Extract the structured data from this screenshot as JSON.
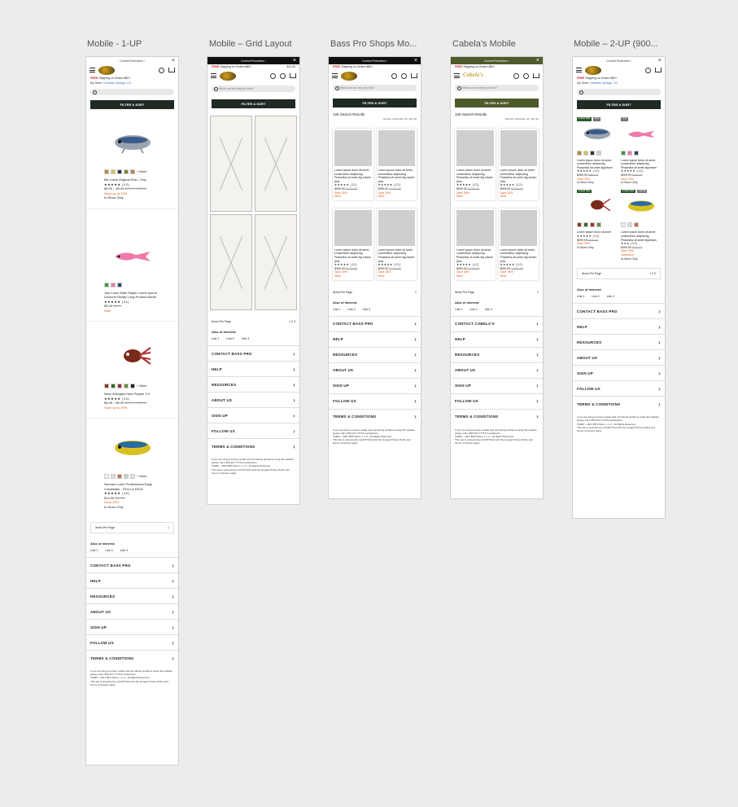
{
  "frames": [
    {
      "title": "Mobile - 1-UP"
    },
    {
      "title": "Mobile – Grid Layout"
    },
    {
      "title": "Bass Pro Shops Mo..."
    },
    {
      "title": "Cabela's Mobile"
    },
    {
      "title": "Mobile – 2-UP (900..."
    }
  ],
  "common": {
    "promo": "Current Promotion ›",
    "ship_free": "FREE",
    "ship_rest": " Shipping on Orders $50+",
    "store_label": "My Store: ",
    "store_name": "Colorado Springs, CO",
    "search_placeholder": "What can we help you find?",
    "filter": "FILTER & SORT",
    "results": "105 Search Results",
    "num_results": "Number of Results: 24 | 48 | 96",
    "items_per_page": "Items Per Page",
    "pages": "1 2 3",
    "page1": "1",
    "also": "Also of interest:",
    "links": [
      "Link 1",
      "Link 2",
      "Link 3"
    ],
    "legal1": "If you are using a screen reader and are having problems using this website, please call 1-800-227-7776 for assistance.",
    "legal2": "©2006 – 2021 BPS Direct, L.L.C., All Rights Reserved",
    "legal3": "This site is protected by reCAPTCHA and the Google Privacy Policy and Terms of Service apply.",
    "price_mini": "$11.00"
  },
  "acc_bps": [
    "CONTACT BASS PRO",
    "HELP",
    "RESOURCES",
    "ABOUT US",
    "SIGN UP",
    "FOLLOW US",
    "TERMS & CONDITIONS"
  ],
  "acc_cab": [
    "CONTACT CABELA'S",
    "HELP",
    "RESOURCES",
    "ABOUT US",
    "SIGN UP",
    "FOLLOW US",
    "TERMS & CONDITIONS"
  ],
  "products_1up": [
    {
      "name": "Bill Lewis Original Rat-L-Trap",
      "rating": "★★★★★ (10)",
      "price": "$5.99 – $9.99",
      "was": "$4.99 – $10.99",
      "save": "Save up to 20%",
      "extra": "In-Store Only",
      "more": "+ More"
    },
    {
      "name": "Jaw Lures Mahi Slayer Lorem Ipsum Dolorem Really Long Product Name",
      "rating": "★★★★★ (11)",
      "price": "$5.99",
      "was": "$6.99",
      "save": "Sale",
      "extra": "",
      "more": ""
    },
    {
      "name": "New! Arbogast Hula Popper 2.0",
      "rating": "★★★★★ (10)",
      "price": "$5.99 – $9.99",
      "was": "$4.99 – $10.99",
      "save": "Save up to 20%",
      "extra": "",
      "more": "+ More"
    },
    {
      "name": "Norman Lures Professional Edge Crankbaits - DD14 & DD22",
      "rating": "★★★★★ (10)",
      "price": "$14.99",
      "was": "$19.99",
      "save": "Save 25%",
      "extra": "In-Store Only",
      "more": "+ More"
    }
  ],
  "grid_card": {
    "name": "Lorem ipsum dolor sit amet, consectetur adipiscing Phasellus sit amet dig nissim (this",
    "rating": "★★★★★ (12)",
    "price": "$999.99",
    "was": "$1299.99",
    "save": "Save 35%",
    "flag": "New!"
  },
  "twoup": [
    {
      "name": "Lorem ipsum dolor sit amet, consectetur adipiscing Phasellus sit amet dignissim",
      "rating": "★★★★★ (12)",
      "price": "$999.99",
      "was": "$999.99",
      "save": "Save 25%",
      "extra": "In-Store Only",
      "badges": [
        "Limited Offer",
        "New"
      ]
    },
    {
      "name": "Lorem ipsum dolor sit amet, consectetur adipiscing Phasellus sit amet dignissim",
      "rating": "★★★★★ (12)",
      "price": "$999.99",
      "was": "$999.99",
      "save": "Save 25%",
      "extra": "In-Store Only",
      "badges": [
        "New"
      ]
    },
    {
      "name": "Lorem ipsum dolor sit amet",
      "rating": "★★★★★ (12)",
      "price": "$999.99",
      "was": "$999.99",
      "save": "Save 25%",
      "extra": "In-Store Only",
      "badges": [
        "Limited Offer"
      ]
    },
    {
      "name": "Lorem ipsum dolor sit amet, consectetur adipiscing Phasellus sit amet dignissim",
      "rating": "★★★ (12)",
      "price": "$999.99",
      "was": "$999.99",
      "save": "Save 25%",
      "extra2": "Clearance",
      "extra": "In-Store Only",
      "badges": [
        "Limited Offer",
        "Special"
      ]
    }
  ],
  "colors": {
    "bg": "#ececec",
    "filter": "#22332a",
    "cabela": "#4d5a2a",
    "accent_red": "#d4262a",
    "save": "#e05a1c",
    "link": "#2e6db5"
  }
}
